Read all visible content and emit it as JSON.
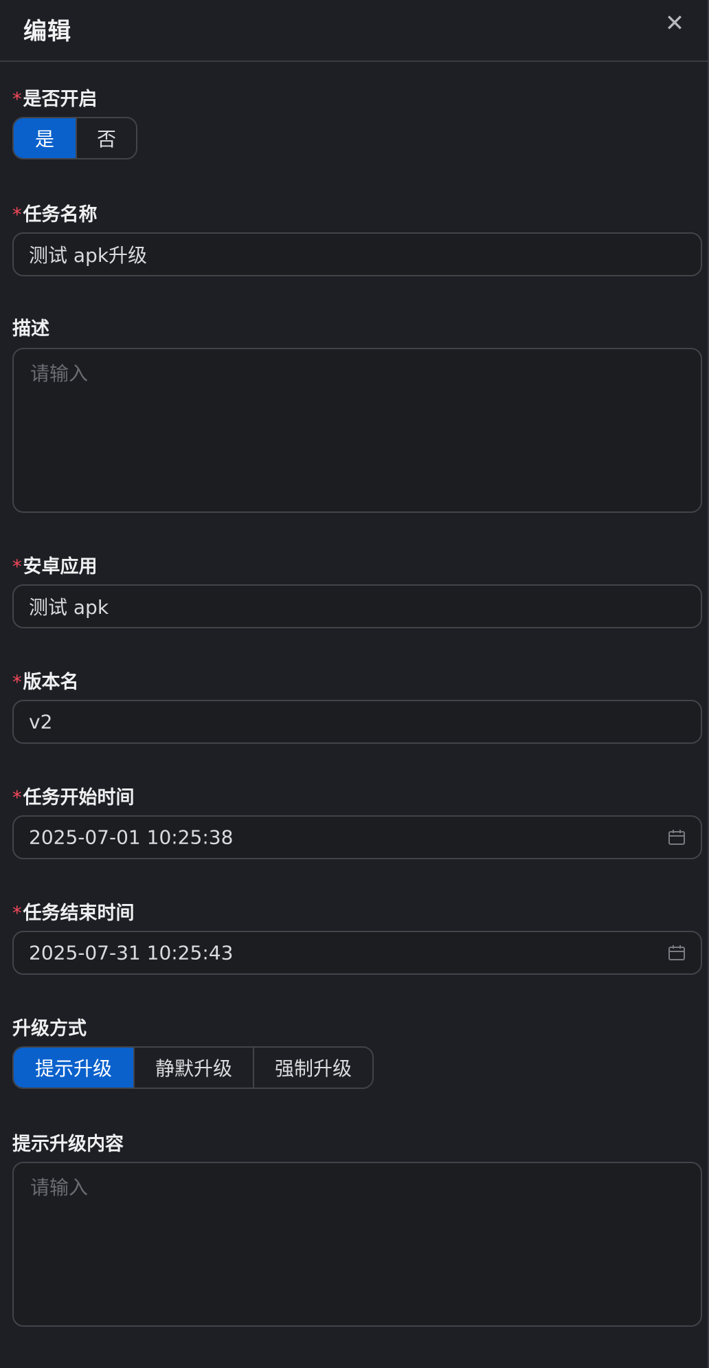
{
  "header": {
    "title": "编辑",
    "close_icon": "close-icon"
  },
  "fields": {
    "enabled": {
      "label": "是否开启",
      "required_mark": "*",
      "options": [
        "是",
        "否"
      ],
      "selected": "是"
    },
    "task_name": {
      "label": "任务名称",
      "required_mark": "*",
      "value": "测试 apk升级"
    },
    "description": {
      "label": "描述",
      "placeholder": "请输入"
    },
    "android_app": {
      "label": "安卓应用",
      "required_mark": "*",
      "value": "测试 apk"
    },
    "version_name": {
      "label": "版本名",
      "required_mark": "*",
      "value": "v2"
    },
    "start_time": {
      "label": "任务开始时间",
      "required_mark": "*",
      "value": "2025-07-01 10:25:38",
      "icon": "calendar-icon"
    },
    "end_time": {
      "label": "任务结束时间",
      "required_mark": "*",
      "value": "2025-07-31 10:25:43",
      "icon": "calendar-icon"
    },
    "upgrade_mode": {
      "label": "升级方式",
      "options": [
        "提示升级",
        "静默升级",
        "强制升级"
      ],
      "selected": "提示升级"
    },
    "upgrade_content": {
      "label": "提示升级内容",
      "placeholder": "请输入"
    }
  },
  "colors": {
    "background": "#1e1f24",
    "accent": "#0a61cc",
    "required": "#f5495b",
    "border": "#43444a"
  }
}
